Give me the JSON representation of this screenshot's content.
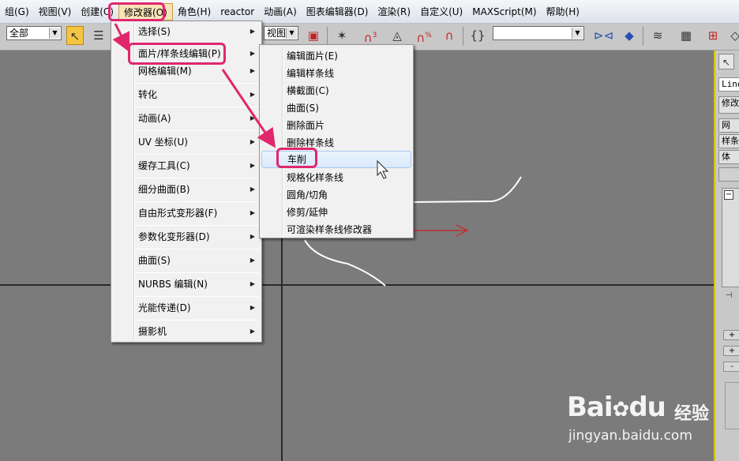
{
  "menubar": {
    "items": [
      "组(G)",
      "视图(V)",
      "创建(C)",
      "修改器(O)",
      "角色(H)",
      "reactor",
      "动画(A)",
      "图表编辑器(D)",
      "渲染(R)",
      "自定义(U)",
      "MAXScript(M)",
      "帮助(H)"
    ],
    "active_index": 3
  },
  "toolbar": {
    "selection_filter": "全部",
    "view_combo": "视图",
    "named_selection": "",
    "snap_label": "3",
    "angle_label": "%"
  },
  "menu_modifiers": {
    "items": [
      {
        "label": "选择(S)",
        "submenu": true
      },
      {
        "label": "面片/样条线编辑(P)",
        "submenu": true
      },
      {
        "label": "网格编辑(M)",
        "submenu": true
      },
      {
        "label": "转化",
        "submenu": true
      },
      {
        "label": "动画(A)",
        "submenu": true
      },
      {
        "label": "UV 坐标(U)",
        "submenu": true
      },
      {
        "label": "缓存工具(C)",
        "submenu": true
      },
      {
        "label": "细分曲面(B)",
        "submenu": true
      },
      {
        "label": "自由形式变形器(F)",
        "submenu": true
      },
      {
        "label": "参数化变形器(D)",
        "submenu": true
      },
      {
        "label": "曲面(S)",
        "submenu": true
      },
      {
        "label": "NURBS 编辑(N)",
        "submenu": true
      },
      {
        "label": "光能传递(D)",
        "submenu": true
      },
      {
        "label": "摄影机",
        "submenu": true
      }
    ]
  },
  "menu_patch_spline": {
    "items": [
      "编辑面片(E)",
      "编辑样条线",
      "横截面(C)",
      "曲面(S)",
      "删除面片",
      "删除样条线",
      "车削",
      "规格化样条线",
      "圆角/切角",
      "修剪/延伸",
      "可渲染样条线修改器"
    ],
    "hover_index": 6
  },
  "command_panel": {
    "object_name": "Line",
    "modifier_list": "修改",
    "buttons": [
      "网",
      "样条",
      "体"
    ],
    "plus": "+",
    "minus": "-"
  },
  "watermark": {
    "brand": "Bai",
    "brand_suffix": "du",
    "cn": "经验",
    "url": "jingyan.baidu.com"
  },
  "colors": {
    "annotation": "#e0276e",
    "menu_hover": "#d9e9fa",
    "viewport": "#7b7b7b",
    "active_viewport_border": "#d7c400"
  }
}
